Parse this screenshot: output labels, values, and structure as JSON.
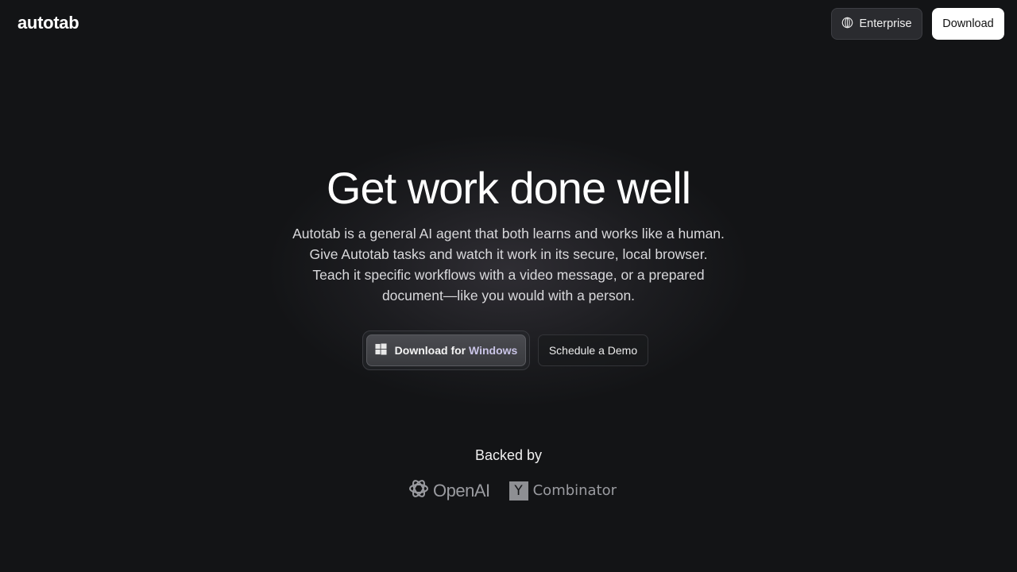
{
  "header": {
    "logo": "autotab",
    "enterprise_label": "Enterprise",
    "download_label": "Download"
  },
  "hero": {
    "title": "Get work done well",
    "description_lines": [
      "Autotab is a general AI agent that both learns and works like a human.",
      "Give Autotab tasks and watch it work in its secure, local browser.",
      "Teach it specific workflows with a video message, or a prepared",
      "document—like you would with a person."
    ],
    "cta_download_prefix": "Download for ",
    "cta_download_platform": "Windows",
    "cta_demo": "Schedule a Demo"
  },
  "backers": {
    "label": "Backed by",
    "openai_text": "OpenAI",
    "yc_letter": "Y",
    "yc_text": "Combinator"
  },
  "icons": {
    "enterprise": "globe-icon",
    "cta": "windows-icon",
    "openai": "openai-logo-icon"
  },
  "colors": {
    "background": "#131416",
    "accent_text": "#c9c4e6",
    "primary_button": "#ffffff"
  }
}
